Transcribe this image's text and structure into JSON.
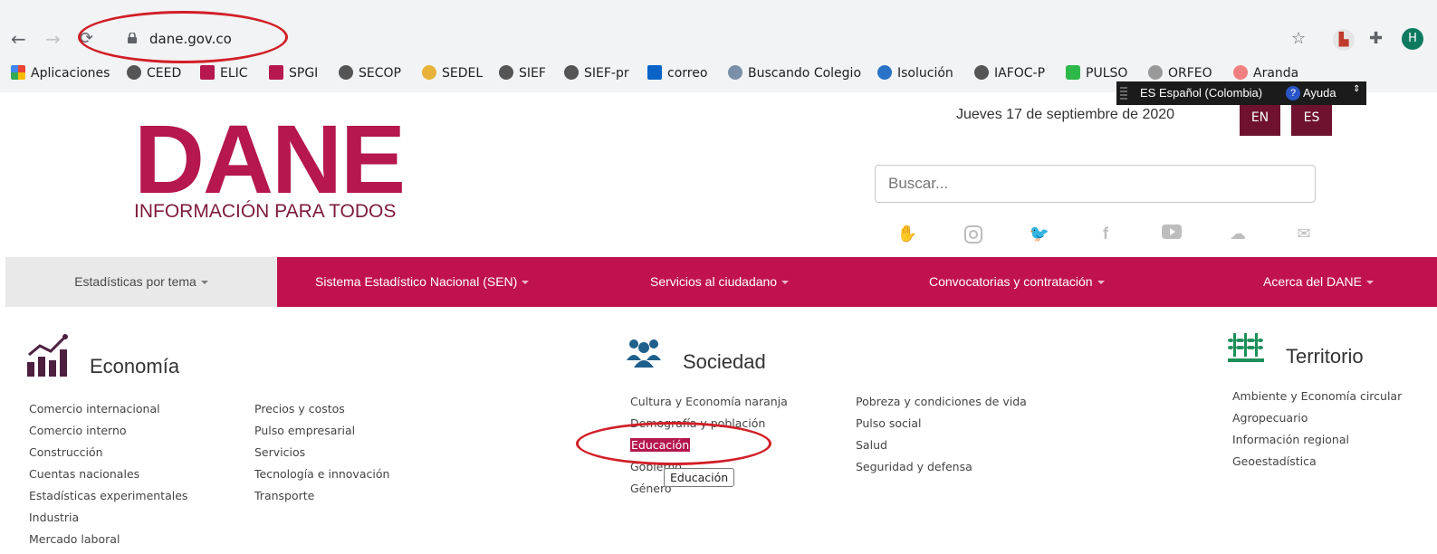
{
  "browser": {
    "url": "dane.gov.co",
    "bookmarks": [
      "Aplicaciones",
      "CEED",
      "ELIC",
      "SPGI",
      "SECOP",
      "SEDEL",
      "SIEF",
      "SIEF-pr",
      "correo",
      "Buscando Colegio",
      "Isolución",
      "IAFOC-P",
      "PULSO",
      "ORFEO",
      "Aranda"
    ],
    "language_bar": {
      "language": "ES Español (Colombia)",
      "help": "Ayuda"
    },
    "profile_initial": "H"
  },
  "header": {
    "logo_word": "DANE",
    "logo_tagline": "INFORMACIÓN PARA TODOS",
    "date": "Jueves 17 de septiembre de 2020",
    "lang_en": "EN",
    "lang_es": "ES",
    "search_placeholder": "Buscar..."
  },
  "social_icons": [
    "hands-icon",
    "instagram-icon",
    "twitter-icon",
    "facebook-icon",
    "youtube-icon",
    "soundcloud-icon",
    "mail-icon"
  ],
  "menu": [
    "Estadísticas por tema",
    "Sistema Estadístico Nacional (SEN)",
    "Servicios al ciudadano",
    "Convocatorias y contratación",
    "Acerca del DANE"
  ],
  "categories": {
    "economia": {
      "title": "Economía",
      "col1": [
        "Comercio internacional",
        "Comercio interno",
        "Construcción",
        "Cuentas nacionales",
        "Estadísticas experimentales",
        "Industria",
        "Mercado laboral"
      ],
      "col2": [
        "Precios y costos",
        "Pulso empresarial",
        "Servicios",
        "Tecnología e innovación",
        "Transporte"
      ]
    },
    "sociedad": {
      "title": "Sociedad",
      "col1": [
        "Cultura y Economía naranja",
        "Demografía y población",
        "Educación",
        "Gobierno",
        "Género"
      ],
      "col2": [
        "Pobreza y condiciones de vida",
        "Pulso social",
        "Salud",
        "Seguridad y defensa"
      ]
    },
    "territorio": {
      "title": "Territorio",
      "col1": [
        "Ambiente y Economía circular",
        "Agropecuario",
        "Información regional",
        "Geoestadística"
      ]
    }
  },
  "tooltip": "Educación",
  "colors": {
    "brand": "#c0124e",
    "brand_dark": "#6e1230",
    "annotation": "#d11f27"
  }
}
